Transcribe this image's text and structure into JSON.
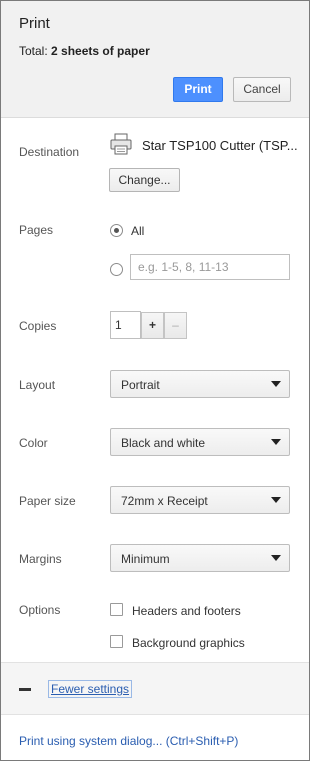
{
  "header": {
    "title": "Print",
    "total_prefix": "Total:",
    "total_value": "2 sheets of paper",
    "print_label": "Print",
    "cancel_label": "Cancel"
  },
  "destination": {
    "label": "Destination",
    "printer_name": "Star TSP100 Cutter (TSP...",
    "change_label": "Change...",
    "icon": "printer-icon"
  },
  "pages": {
    "label": "Pages",
    "all_label": "All",
    "all_selected": true,
    "custom_placeholder": "e.g. 1-5, 8, 11-13",
    "custom_value": ""
  },
  "copies": {
    "label": "Copies",
    "value": "1",
    "plus": "+",
    "minus": "–"
  },
  "layout": {
    "label": "Layout",
    "value": "Portrait"
  },
  "color": {
    "label": "Color",
    "value": "Black and white"
  },
  "paper_size": {
    "label": "Paper size",
    "value": "72mm x Receipt"
  },
  "margins": {
    "label": "Margins",
    "value": "Minimum"
  },
  "options": {
    "label": "Options",
    "headers_footers": "Headers and footers",
    "headers_footers_checked": false,
    "background_graphics": "Background graphics",
    "background_graphics_checked": false
  },
  "fewer_settings": {
    "label": "Fewer settings",
    "icon": "collapse-icon"
  },
  "system_dialog": {
    "label": "Print using system dialog... (Ctrl+Shift+P)"
  },
  "colors": {
    "accent": "#4d90fe",
    "link": "#2a5db0",
    "header_bg": "#f1f1f1"
  }
}
